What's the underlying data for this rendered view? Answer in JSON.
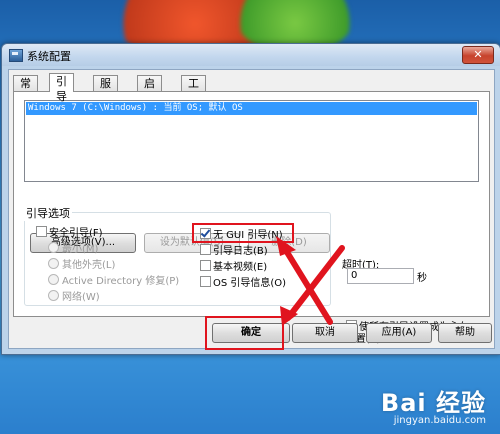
{
  "window": {
    "title": "系统配置",
    "close_glyph": "✕"
  },
  "tabs": [
    "常规",
    "引导",
    "服务",
    "启动",
    "工具"
  ],
  "boot": {
    "os_entry": "Windows 7 (C:\\Windows) : 当前 OS; 默认 OS",
    "advanced_button": "高级选项(V)...",
    "set_default_button": "设为默认值(S)",
    "delete_button": "删除(D)",
    "options_title": "引导选项",
    "safe_boot": "安全引导(F)",
    "minimal": "最小(M)",
    "alternate_shell": "其他外壳(L)",
    "active_directory": "Active Directory 修复(P)",
    "network": "网络(W)",
    "no_gui_boot": "无 GUI 引导(N)",
    "boot_log": "引导日志(B)",
    "base_video": "基本视频(E)",
    "os_boot_info": "OS 引导信息(O)",
    "timeout_label": "超时(T):",
    "timeout_value": "0",
    "timeout_unit": "秒",
    "make_permanent": "使所有引导设置成为永久设置(K)"
  },
  "footer": {
    "ok": "确定",
    "cancel": "取消",
    "apply": "应用(A)",
    "help": "帮助"
  },
  "watermark": {
    "main": "Bai 经验",
    "url": "jingyan.baidu.com"
  },
  "colors": {
    "highlight": "#e0141e",
    "selection": "#3399ff"
  }
}
